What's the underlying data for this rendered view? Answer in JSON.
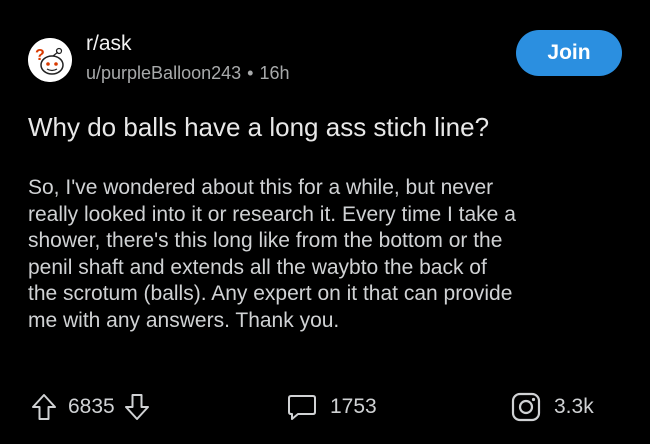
{
  "post": {
    "subreddit": "r/ask",
    "author": "u/purpleBalloon243",
    "separator": "•",
    "age": "16h",
    "join_label": "Join",
    "title": "Why do balls have a long ass stich line?",
    "body_lines": [
      "So, I've wondered about this for a while, but never",
      "really looked into it or research it.  Every time I take a",
      "shower, there's this long like from the bottom or the",
      "penil shaft and extends all the waybto the back of",
      "the scrotum (balls). Any expert on it that can provide",
      "me with any answers. Thank you."
    ]
  },
  "actions": {
    "upvotes": "6835",
    "comments": "1753",
    "shares": "3.3k"
  },
  "colors": {
    "background": "#000000",
    "accent": "#2b8fe0",
    "text": "#d7dadc",
    "muted": "#a8aaab"
  },
  "icons": [
    "subreddit-avatar-icon",
    "upvote-arrow-icon",
    "downvote-arrow-icon",
    "comment-bubble-icon",
    "share-instagram-icon"
  ]
}
